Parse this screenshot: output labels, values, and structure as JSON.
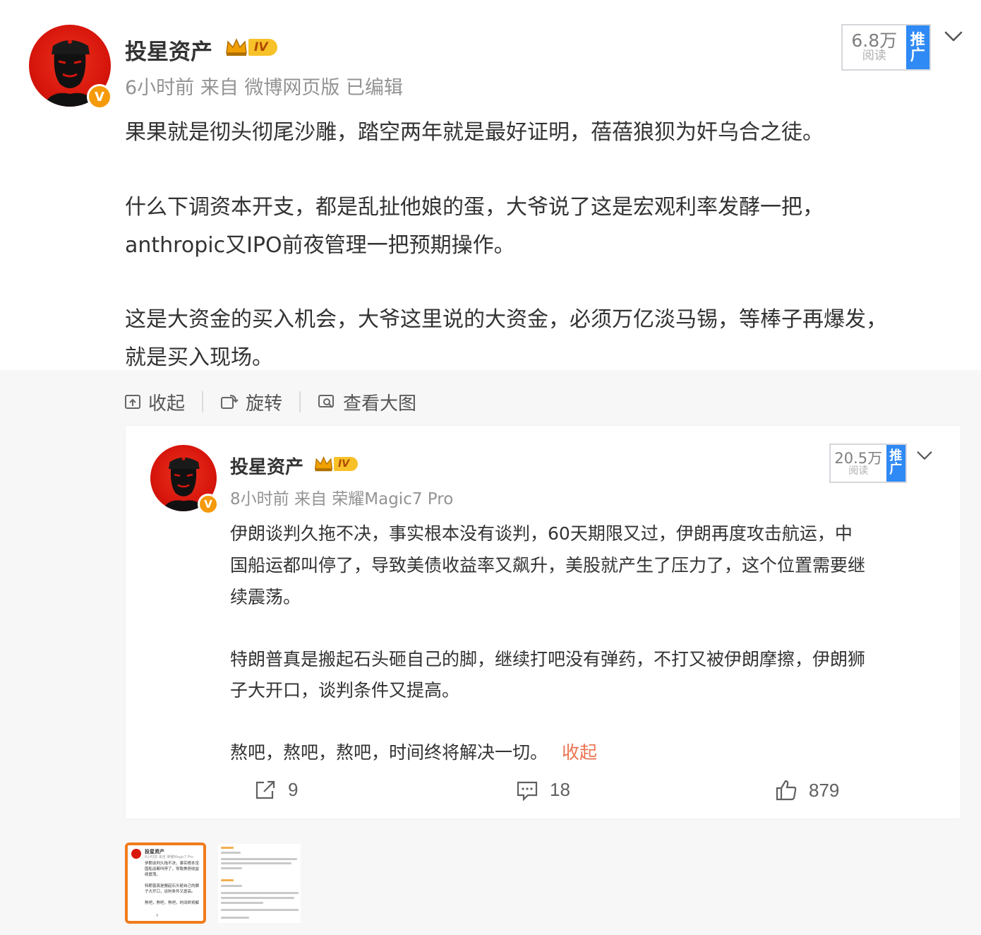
{
  "post": {
    "username": "投星资产",
    "level_badge": "IV",
    "verified_badge": "V",
    "meta": "6小时前  来自  微博网页版  已编辑",
    "reads_number": "6.8万",
    "reads_label": "阅读",
    "promote_line1": "推",
    "promote_line2": "广",
    "text_lines": [
      "果果就是彻头彻尾沙雕，踏空两年就是最好证明，蓓蓓狼狈为奸乌合之徒。",
      "什么下调资本开支，都是乱扯他娘的蛋，大爷说了这是宏观利率发酵一把，",
      "anthropic又IPO前夜管理一把预期操作。",
      "这是大资金的买入机会，大爷这里说的大资金，必须万亿淡马锡，等棒子再爆发，",
      "就是买入现场。"
    ]
  },
  "image_toolbar": {
    "collapse": "收起",
    "rotate": "旋转",
    "view_large": "查看大图"
  },
  "embedded": {
    "username": "投星资产",
    "level_badge": "IV",
    "verified_badge": "V",
    "meta": "8小时前  来自  荣耀Magic7 Pro",
    "reads_number": "20.5万",
    "reads_label": "阅读",
    "promote_line1": "推",
    "promote_line2": "广",
    "text_lines": [
      "伊朗谈判久拖不决，事实根本没有谈判，60天期限又过，伊朗再度攻击航运，中",
      "国船运都叫停了，导致美债收益率又飙升，美股就产生了压力了，这个位置需要继",
      "续震荡。",
      "特朗普真是搬起石头砸自己的脚，继续打吧没有弹药，不打又被伊朗摩擦，伊朗狮",
      "子大开口，谈判条件又提高。",
      "熬吧，熬吧，熬吧，时间终将解决一切。"
    ],
    "collapse_link": "收起",
    "repost_count": "9",
    "comment_count": "18",
    "like_count": "879"
  },
  "thumbnails": {
    "selected_username": "投星资产",
    "selected_lines": [
      "伊朗谈判久拖不决，事实根本没",
      "国船运都叫停了，导致美债收益",
      "续震荡。",
      "特朗普真是搬起石头砸自己的脚",
      "子大开口，谈判条件又提高。",
      "熬吧，熬吧，熬吧，时间终将解"
    ],
    "selected_meta": "8小时前 来自 荣耀Magic7 Pro",
    "selected_count": "9"
  },
  "colors": {
    "verified": "#f59a0a",
    "promote": "#2f8af5",
    "collapse_link": "#eb7350",
    "thumb_selected_border": "#f07c1c",
    "avatar_red": "#d8160c"
  },
  "icons": [
    "chevron-down-icon",
    "collapse-icon",
    "rotate-icon",
    "view-large-icon",
    "repost-icon",
    "comment-icon",
    "like-icon",
    "crown-icon"
  ]
}
